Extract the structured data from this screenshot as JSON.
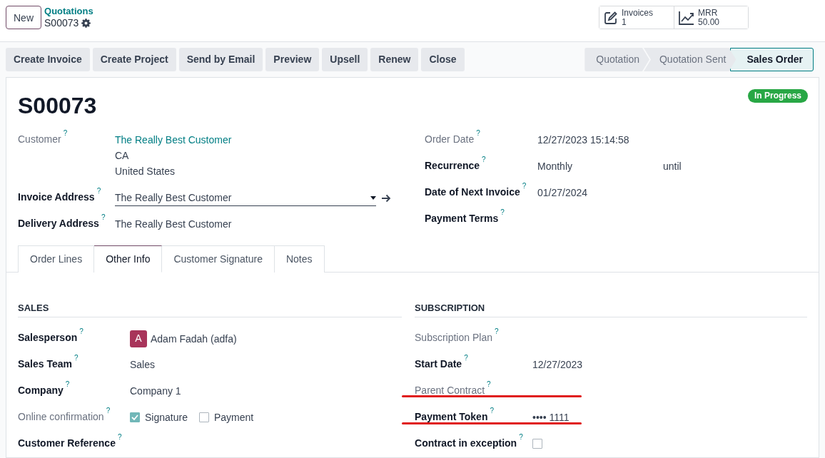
{
  "control_panel": {
    "new_button": "New",
    "breadcrumb": {
      "parent": "Quotations",
      "current": "S00073"
    },
    "stat_buttons": [
      {
        "kind": "invoices",
        "label": "Invoices",
        "value": "1"
      },
      {
        "kind": "chart",
        "label": "MRR",
        "value": "50.00"
      }
    ]
  },
  "action_buttons": [
    "Create Invoice",
    "Create Project",
    "Send by Email",
    "Preview",
    "Upsell",
    "Renew",
    "Close"
  ],
  "status_bar": [
    {
      "label": "Quotation",
      "selected": false
    },
    {
      "label": "Quotation Sent",
      "selected": false
    },
    {
      "label": "Sales Order",
      "selected": true
    }
  ],
  "sheet": {
    "title": "S00073",
    "status_badge": "In Progress",
    "left_fields": [
      {
        "label": "Customer",
        "help": "?",
        "muted": true,
        "kind": "link",
        "value": "The Really Best Customer",
        "extra_lines": [
          "CA",
          "United States"
        ]
      },
      {
        "label": "Invoice Address",
        "help": "?",
        "muted": false,
        "kind": "select",
        "value": "The Really Best Customer"
      },
      {
        "label": "Delivery Address",
        "help": "?",
        "muted": false,
        "kind": "text",
        "value": "The Really Best Customer"
      }
    ],
    "right_fields": [
      {
        "label": "Order Date",
        "help": "?",
        "muted": true,
        "kind": "text",
        "value": "12/27/2023 15:14:58"
      },
      {
        "label": "Recurrence",
        "help": "?",
        "muted": false,
        "kind": "recurrence",
        "value": "Monthly",
        "suffix": "until"
      },
      {
        "label": "Date of Next Invoice",
        "help": "?",
        "muted": false,
        "kind": "text",
        "value": "01/27/2024"
      },
      {
        "label": "Payment Terms",
        "help": "?",
        "muted": false,
        "kind": "empty"
      }
    ]
  },
  "tabs": [
    {
      "label": "Order Lines",
      "selected": false
    },
    {
      "label": "Other Info",
      "selected": true
    },
    {
      "label": "Customer Signature",
      "selected": false
    },
    {
      "label": "Notes",
      "selected": false
    }
  ],
  "sections": [
    {
      "title": "SALES",
      "fields": [
        {
          "label": "Salesperson",
          "help": "?",
          "muted": false,
          "kind": "avatar",
          "initial": "A",
          "value": "Adam Fadah (adfa)"
        },
        {
          "label": "Sales Team",
          "help": "?",
          "muted": false,
          "kind": "text",
          "value": "Sales"
        },
        {
          "label": "Company",
          "help": "?",
          "muted": false,
          "kind": "text",
          "value": "Company 1"
        },
        {
          "label": "Online confirmation",
          "help": "?",
          "muted": true,
          "kind": "checkboxes",
          "options": [
            {
              "label": "Signature",
              "checked": true
            },
            {
              "label": "Payment",
              "checked": false
            }
          ]
        },
        {
          "label": "Customer Reference",
          "help": "?",
          "muted": false,
          "kind": "empty"
        }
      ]
    },
    {
      "title": "SUBSCRIPTION",
      "fields": [
        {
          "label": "Subscription Plan",
          "help": "?",
          "muted": true,
          "kind": "empty"
        },
        {
          "label": "Start Date",
          "help": "?",
          "muted": false,
          "kind": "text",
          "value": "12/27/2023"
        },
        {
          "label": "Parent Contract",
          "help": "?",
          "muted": true,
          "kind": "empty"
        },
        {
          "label": "Payment Token",
          "help": "?",
          "muted": false,
          "kind": "text",
          "value": "•••• 1111",
          "highlighted": true
        },
        {
          "label": "Contract in exception",
          "help": "?",
          "muted": false,
          "kind": "checkbox",
          "checked": false
        }
      ]
    }
  ]
}
